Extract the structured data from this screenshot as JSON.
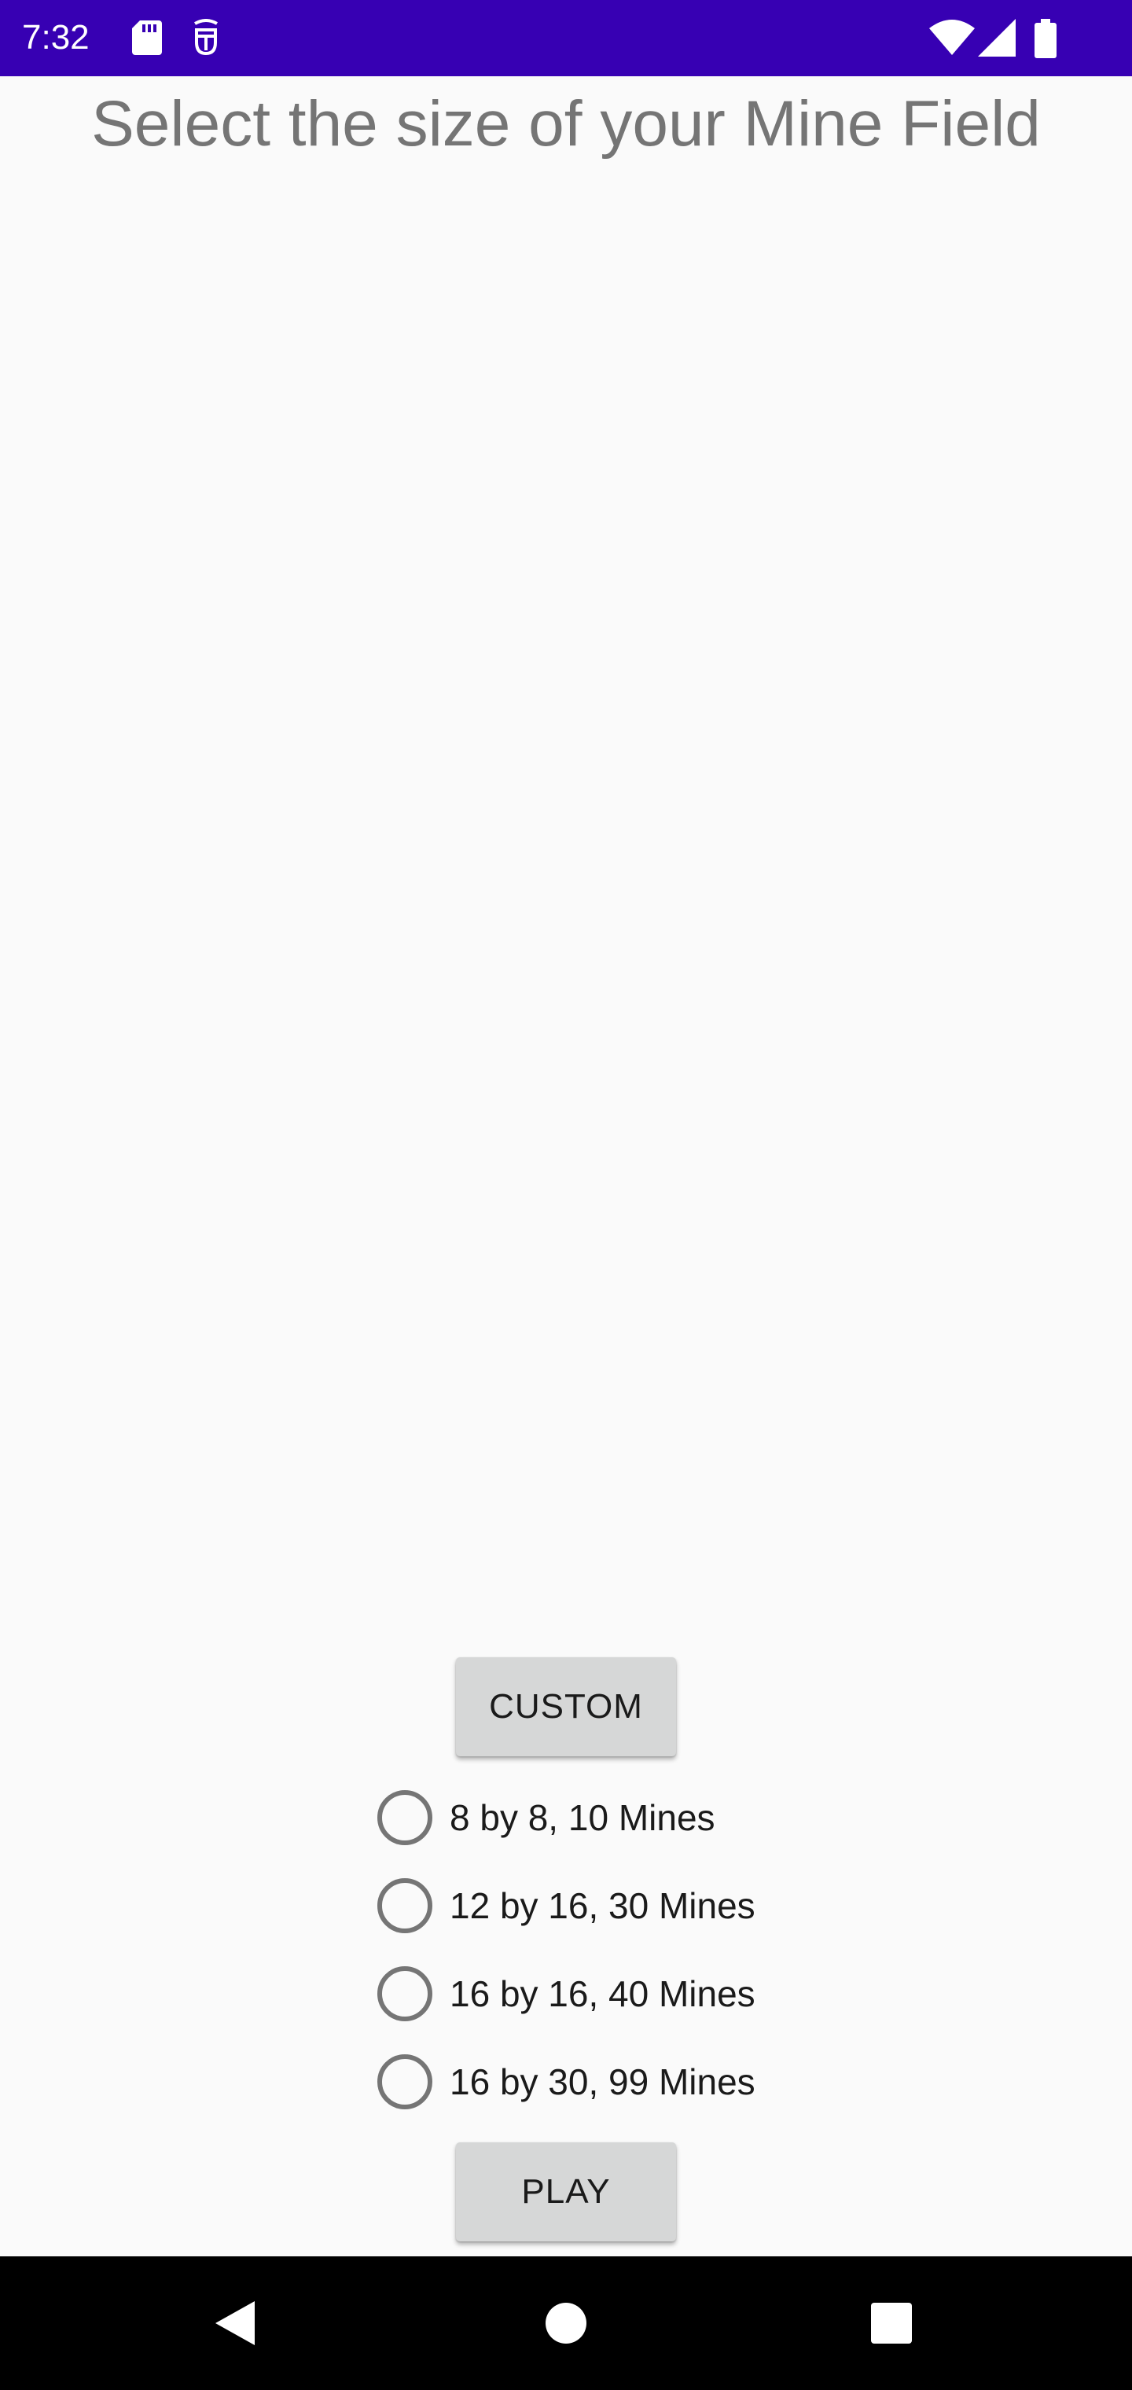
{
  "status_bar": {
    "time": "7:32",
    "icons": [
      "sd-card-icon",
      "debug-icon",
      "wifi-icon",
      "signal-icon",
      "battery-icon"
    ],
    "background": "#3700b3"
  },
  "title": "Select the size of your Mine Field",
  "custom_button": {
    "label": "CUSTOM"
  },
  "options": [
    {
      "label": "8 by 8, 10 Mines",
      "selected": false
    },
    {
      "label": "12 by 16, 30 Mines",
      "selected": false
    },
    {
      "label": "16 by 16, 40 Mines",
      "selected": false
    },
    {
      "label": "16 by 30, 99 Mines",
      "selected": false
    }
  ],
  "play_button": {
    "label": "PLAY"
  },
  "nav_bar": {
    "icons": [
      "back-icon",
      "home-icon",
      "recents-icon"
    ]
  },
  "colors": {
    "title": "#757575",
    "button": "#d6d7d7",
    "radio_border": "#757575"
  }
}
